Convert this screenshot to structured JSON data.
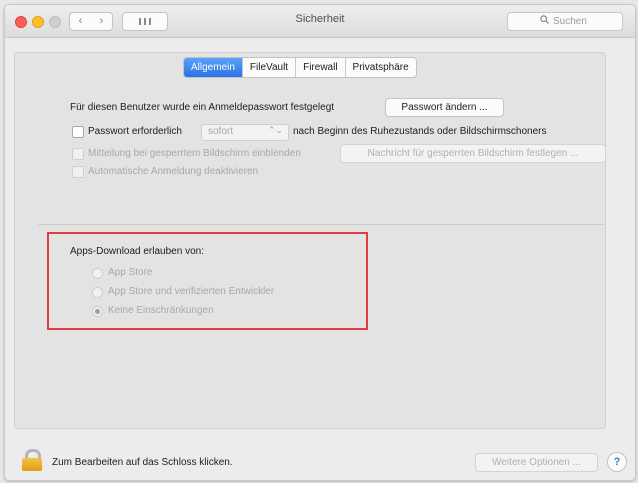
{
  "window": {
    "title": "Sicherheit"
  },
  "toolbar": {
    "back_glyph": "‹",
    "forward_glyph": "›",
    "search_placeholder": "Suchen",
    "search_icon": "magnifier-icon"
  },
  "tabs": [
    {
      "label": "Allgemein",
      "active": true
    },
    {
      "label": "FileVault",
      "active": false
    },
    {
      "label": "Firewall",
      "active": false
    },
    {
      "label": "Privatsphäre",
      "active": false
    }
  ],
  "general": {
    "login_password_text": "Für diesen Benutzer wurde ein Anmeldepasswort festgelegt",
    "change_password_button": "Passwort ändern ...",
    "require_password": {
      "label": "Passwort erforderlich",
      "checked": false,
      "popup_value": "sofort",
      "suffix": "nach Beginn des Ruhezustands oder Bildschirmschoners"
    },
    "show_message": {
      "label": "Mitteilung bei gesperrtem Bildschirm einblenden",
      "checked": false,
      "enabled": false,
      "button": "Nachricht für gesperrten Bildschirm festlegen ..."
    },
    "disable_auto_login": {
      "label": "Automatische Anmeldung deaktivieren",
      "checked": false,
      "enabled": false
    }
  },
  "apps_download": {
    "heading": "Apps-Download erlauben von:",
    "options": [
      {
        "label": "App Store",
        "selected": false
      },
      {
        "label": "App Store und verifizierten Entwickler",
        "selected": false
      },
      {
        "label": "Keine Einschränkungen",
        "selected": true
      }
    ],
    "highlight_color": "#e23c3c"
  },
  "footer": {
    "lock_text": "Zum Bearbeiten auf das Schloss klicken.",
    "more_options_button": "Weitere Optionen ...",
    "help_label": "?"
  },
  "colors": {
    "accent": "#2a72e2",
    "lock": "#e19c16"
  }
}
